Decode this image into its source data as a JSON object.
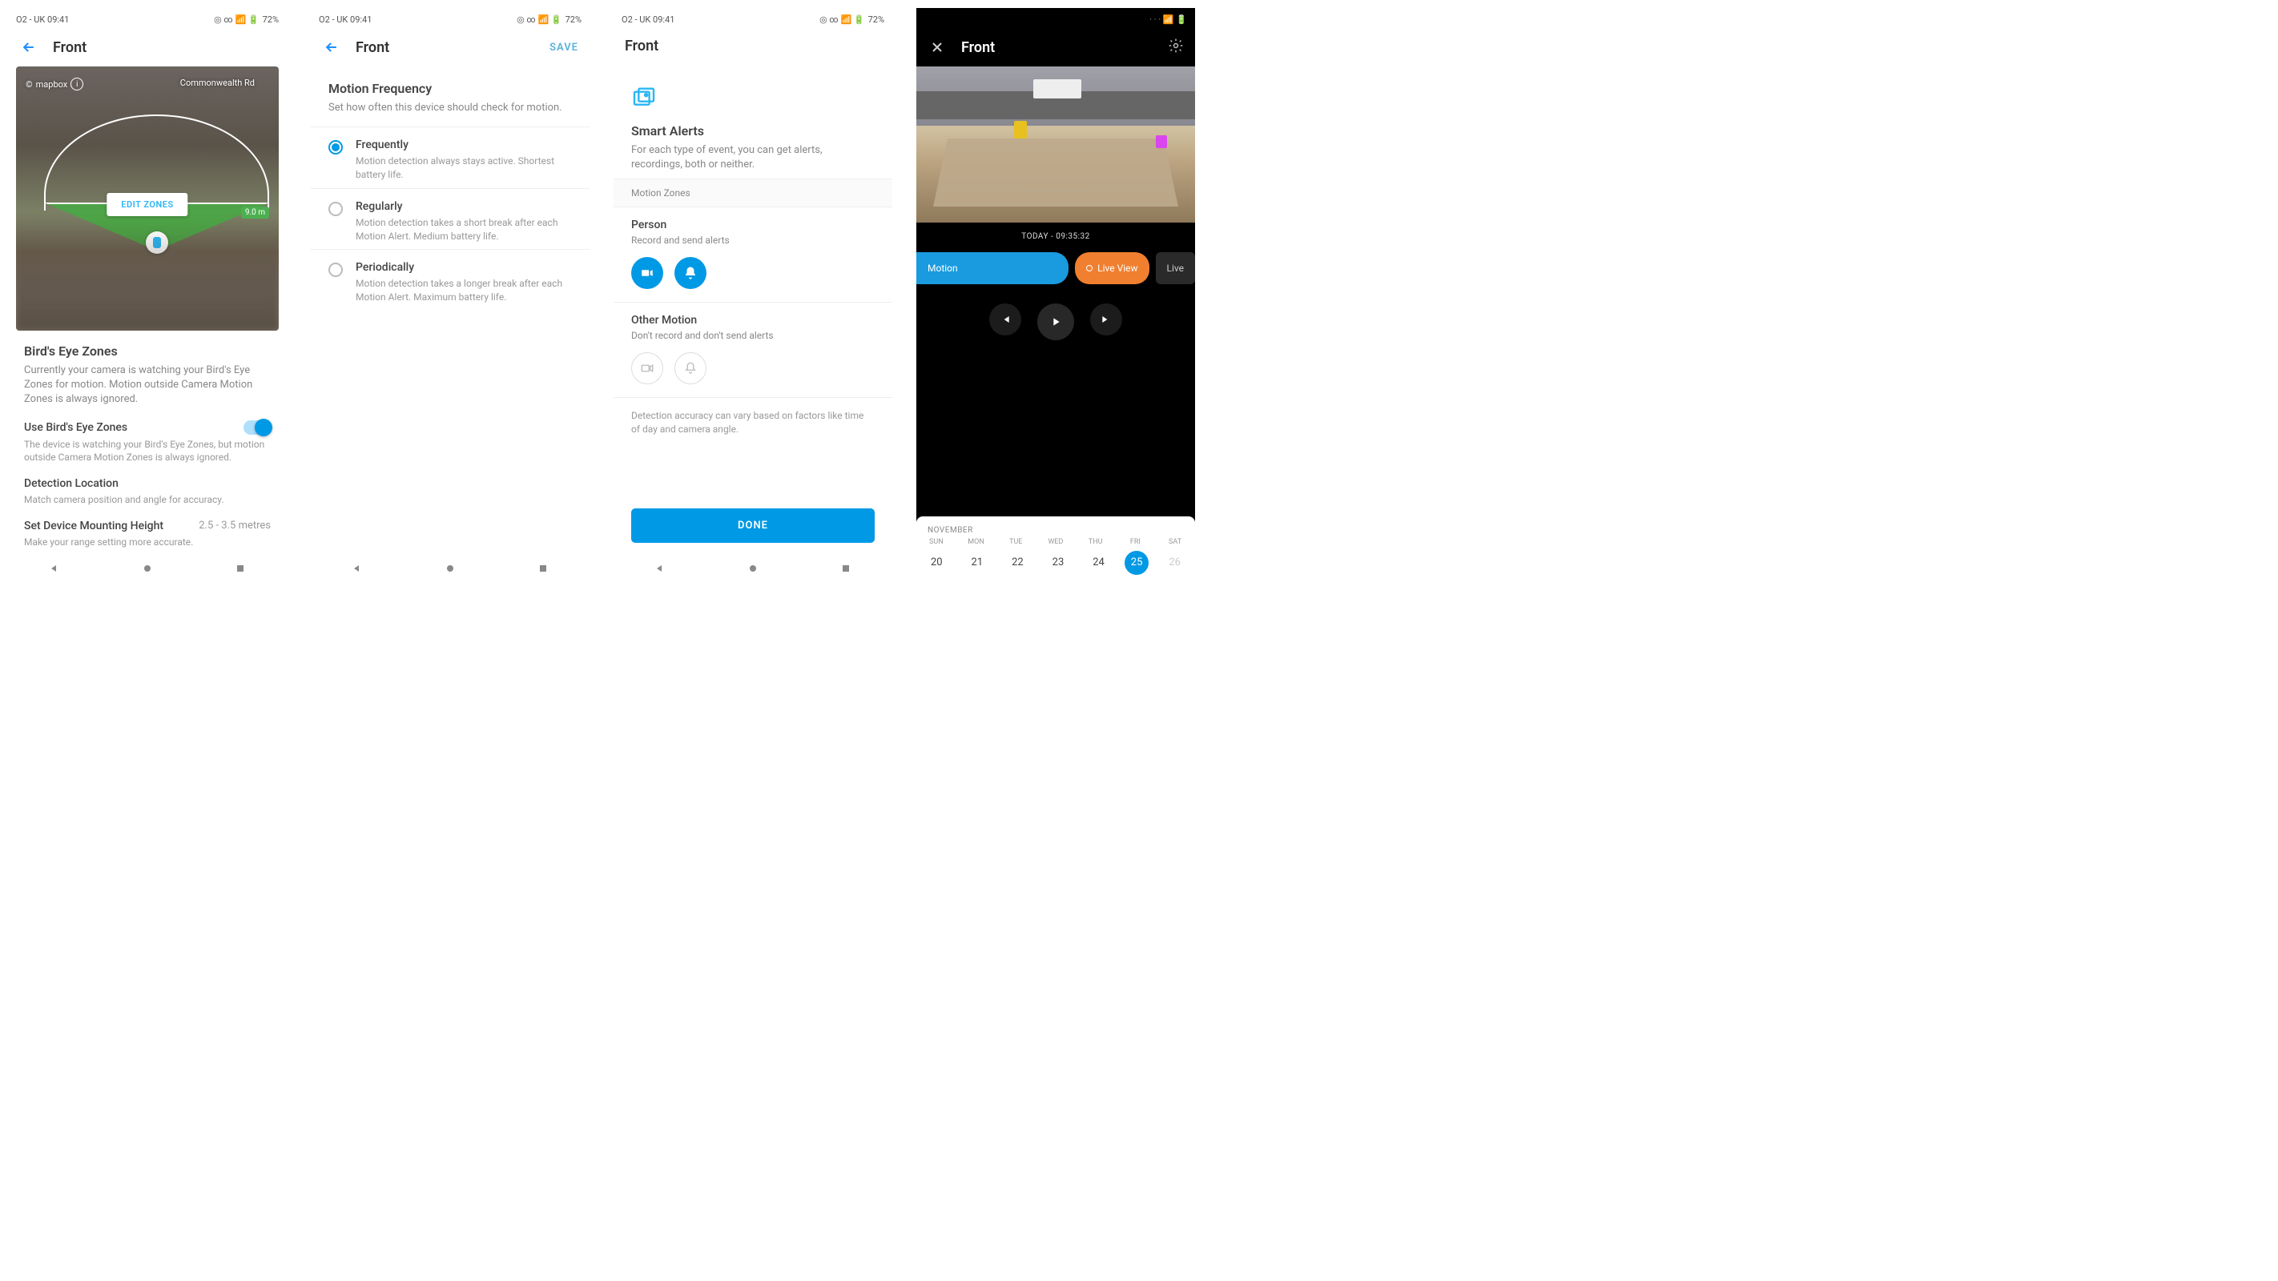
{
  "status_bar": {
    "carrier_time": "O2 - UK 09:41",
    "battery": "72%",
    "signal_icons": "📶"
  },
  "screen1": {
    "header_title": "Front",
    "map": {
      "road_left": "mapbox",
      "road_right": "Commonwealth Rd",
      "distance_chip": "9.0 m",
      "edit_button": "EDIT ZONES"
    },
    "birds_eye": {
      "title": "Bird's Eye Zones",
      "desc": "Currently your camera is watching your Bird's Eye Zones for motion. Motion outside Camera Motion Zones is always ignored."
    },
    "use_zones": {
      "title": "Use Bird's Eye Zones",
      "desc": "The device is watching your Bird's Eye Zones, but motion outside Camera Motion Zones is always ignored."
    },
    "detection": {
      "title": "Detection Location",
      "desc": "Match camera position and angle for accuracy."
    },
    "mount": {
      "title": "Set Device Mounting Height",
      "value": "2.5 - 3.5 metres",
      "desc": "Make your range setting more accurate."
    }
  },
  "screen2": {
    "header_title": "Front",
    "save": "SAVE",
    "heading": {
      "title": "Motion Frequency",
      "desc": "Set how often this device should check for motion."
    },
    "options": [
      {
        "title": "Frequently",
        "desc": "Motion detection always stays active. Shortest battery life.",
        "selected": true
      },
      {
        "title": "Regularly",
        "desc": "Motion detection takes a short break after each Motion Alert. Medium battery life.",
        "selected": false
      },
      {
        "title": "Periodically",
        "desc": "Motion detection takes a longer break after each Motion Alert. Maximum battery life.",
        "selected": false
      }
    ]
  },
  "screen3": {
    "header_title": "Front",
    "smart": {
      "title": "Smart Alerts",
      "desc": "For each type of event, you can get alerts, recordings, both or neither."
    },
    "zone_header": "Motion Zones",
    "person": {
      "title": "Person",
      "desc": "Record and send alerts"
    },
    "other": {
      "title": "Other Motion",
      "desc": "Don't record and don't send alerts"
    },
    "footnote": "Detection accuracy can vary based on factors like time of day and camera angle.",
    "done": "DONE"
  },
  "screen4": {
    "header_title": "Front",
    "timestamp": "TODAY - 09:35:32",
    "timeline": {
      "motion": "Motion",
      "liveview": "Live View",
      "live": "Live"
    },
    "calendar": {
      "month": "NOVEMBER",
      "days": [
        "SUN",
        "MON",
        "TUE",
        "WED",
        "THU",
        "FRI",
        "SAT"
      ],
      "dates": [
        "20",
        "21",
        "22",
        "23",
        "24",
        "25",
        "26"
      ],
      "today_index": 5
    }
  }
}
